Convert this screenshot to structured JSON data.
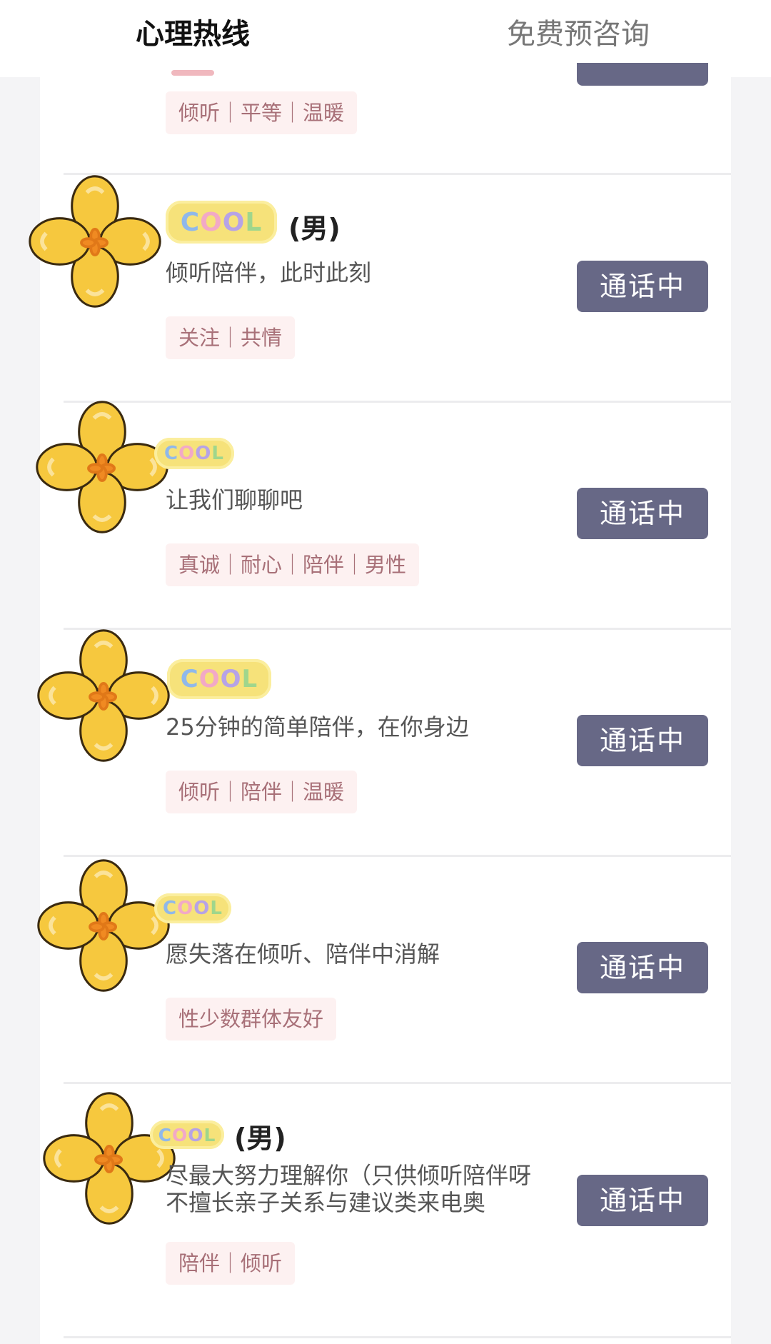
{
  "tabs": {
    "active_label": "心理热线",
    "inactive_label": "免费预咨询",
    "accent_color": "#f0b8be"
  },
  "theme": {
    "button_color": "#676886",
    "tag_background": "#fdf1f1",
    "tag_text_color": "#a87078"
  },
  "avatar_icon": "yellow-flower-sticker",
  "name_sticker": {
    "letters": [
      "C",
      "O",
      "O",
      "L"
    ]
  },
  "list": {
    "partial_item": {
      "tags": "倾听｜平等｜温暖"
    },
    "items": [
      {
        "name_suffix": "(男)",
        "description": "倾听陪伴，此时此刻",
        "tags": "关注｜共情",
        "button_label": "通话中"
      },
      {
        "name_suffix": "",
        "description": "让我们聊聊吧",
        "tags": "真诚｜耐心｜陪伴｜男性",
        "button_label": "通话中"
      },
      {
        "name_suffix": "",
        "description": "25分钟的简单陪伴，在你身边",
        "tags": "倾听｜陪伴｜温暖",
        "button_label": "通话中"
      },
      {
        "name_suffix": "",
        "description": "愿失落在倾听、陪伴中消解",
        "tags": "性少数群体友好",
        "button_label": "通话中"
      },
      {
        "name_suffix": "(男)",
        "description_line1": "尽最大努力理解你（只供倾听陪伴呀",
        "description_line2": "不擅长亲子关系与建议类来电奥",
        "tags": "陪伴｜倾听",
        "button_label": "通话中"
      }
    ]
  }
}
